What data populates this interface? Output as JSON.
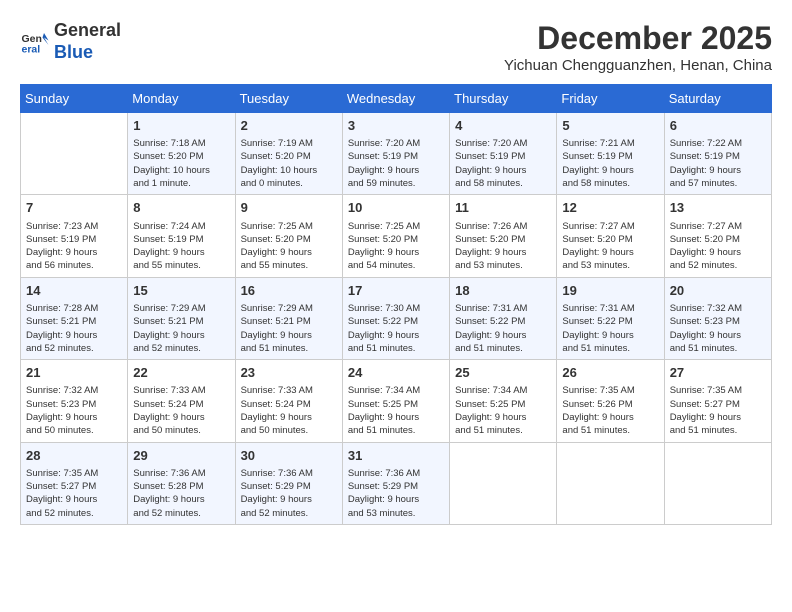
{
  "logo": {
    "line1": "General",
    "line2": "Blue"
  },
  "title": "December 2025",
  "location": "Yichuan Chengguanzhen, Henan, China",
  "headers": [
    "Sunday",
    "Monday",
    "Tuesday",
    "Wednesday",
    "Thursday",
    "Friday",
    "Saturday"
  ],
  "weeks": [
    [
      {
        "day": "",
        "info": ""
      },
      {
        "day": "1",
        "info": "Sunrise: 7:18 AM\nSunset: 5:20 PM\nDaylight: 10 hours\nand 1 minute."
      },
      {
        "day": "2",
        "info": "Sunrise: 7:19 AM\nSunset: 5:20 PM\nDaylight: 10 hours\nand 0 minutes."
      },
      {
        "day": "3",
        "info": "Sunrise: 7:20 AM\nSunset: 5:19 PM\nDaylight: 9 hours\nand 59 minutes."
      },
      {
        "day": "4",
        "info": "Sunrise: 7:20 AM\nSunset: 5:19 PM\nDaylight: 9 hours\nand 58 minutes."
      },
      {
        "day": "5",
        "info": "Sunrise: 7:21 AM\nSunset: 5:19 PM\nDaylight: 9 hours\nand 58 minutes."
      },
      {
        "day": "6",
        "info": "Sunrise: 7:22 AM\nSunset: 5:19 PM\nDaylight: 9 hours\nand 57 minutes."
      }
    ],
    [
      {
        "day": "7",
        "info": "Sunrise: 7:23 AM\nSunset: 5:19 PM\nDaylight: 9 hours\nand 56 minutes."
      },
      {
        "day": "8",
        "info": "Sunrise: 7:24 AM\nSunset: 5:19 PM\nDaylight: 9 hours\nand 55 minutes."
      },
      {
        "day": "9",
        "info": "Sunrise: 7:25 AM\nSunset: 5:20 PM\nDaylight: 9 hours\nand 55 minutes."
      },
      {
        "day": "10",
        "info": "Sunrise: 7:25 AM\nSunset: 5:20 PM\nDaylight: 9 hours\nand 54 minutes."
      },
      {
        "day": "11",
        "info": "Sunrise: 7:26 AM\nSunset: 5:20 PM\nDaylight: 9 hours\nand 53 minutes."
      },
      {
        "day": "12",
        "info": "Sunrise: 7:27 AM\nSunset: 5:20 PM\nDaylight: 9 hours\nand 53 minutes."
      },
      {
        "day": "13",
        "info": "Sunrise: 7:27 AM\nSunset: 5:20 PM\nDaylight: 9 hours\nand 52 minutes."
      }
    ],
    [
      {
        "day": "14",
        "info": "Sunrise: 7:28 AM\nSunset: 5:21 PM\nDaylight: 9 hours\nand 52 minutes."
      },
      {
        "day": "15",
        "info": "Sunrise: 7:29 AM\nSunset: 5:21 PM\nDaylight: 9 hours\nand 52 minutes."
      },
      {
        "day": "16",
        "info": "Sunrise: 7:29 AM\nSunset: 5:21 PM\nDaylight: 9 hours\nand 51 minutes."
      },
      {
        "day": "17",
        "info": "Sunrise: 7:30 AM\nSunset: 5:22 PM\nDaylight: 9 hours\nand 51 minutes."
      },
      {
        "day": "18",
        "info": "Sunrise: 7:31 AM\nSunset: 5:22 PM\nDaylight: 9 hours\nand 51 minutes."
      },
      {
        "day": "19",
        "info": "Sunrise: 7:31 AM\nSunset: 5:22 PM\nDaylight: 9 hours\nand 51 minutes."
      },
      {
        "day": "20",
        "info": "Sunrise: 7:32 AM\nSunset: 5:23 PM\nDaylight: 9 hours\nand 51 minutes."
      }
    ],
    [
      {
        "day": "21",
        "info": "Sunrise: 7:32 AM\nSunset: 5:23 PM\nDaylight: 9 hours\nand 50 minutes."
      },
      {
        "day": "22",
        "info": "Sunrise: 7:33 AM\nSunset: 5:24 PM\nDaylight: 9 hours\nand 50 minutes."
      },
      {
        "day": "23",
        "info": "Sunrise: 7:33 AM\nSunset: 5:24 PM\nDaylight: 9 hours\nand 50 minutes."
      },
      {
        "day": "24",
        "info": "Sunrise: 7:34 AM\nSunset: 5:25 PM\nDaylight: 9 hours\nand 51 minutes."
      },
      {
        "day": "25",
        "info": "Sunrise: 7:34 AM\nSunset: 5:25 PM\nDaylight: 9 hours\nand 51 minutes."
      },
      {
        "day": "26",
        "info": "Sunrise: 7:35 AM\nSunset: 5:26 PM\nDaylight: 9 hours\nand 51 minutes."
      },
      {
        "day": "27",
        "info": "Sunrise: 7:35 AM\nSunset: 5:27 PM\nDaylight: 9 hours\nand 51 minutes."
      }
    ],
    [
      {
        "day": "28",
        "info": "Sunrise: 7:35 AM\nSunset: 5:27 PM\nDaylight: 9 hours\nand 52 minutes."
      },
      {
        "day": "29",
        "info": "Sunrise: 7:36 AM\nSunset: 5:28 PM\nDaylight: 9 hours\nand 52 minutes."
      },
      {
        "day": "30",
        "info": "Sunrise: 7:36 AM\nSunset: 5:29 PM\nDaylight: 9 hours\nand 52 minutes."
      },
      {
        "day": "31",
        "info": "Sunrise: 7:36 AM\nSunset: 5:29 PM\nDaylight: 9 hours\nand 53 minutes."
      },
      {
        "day": "",
        "info": ""
      },
      {
        "day": "",
        "info": ""
      },
      {
        "day": "",
        "info": ""
      }
    ]
  ]
}
